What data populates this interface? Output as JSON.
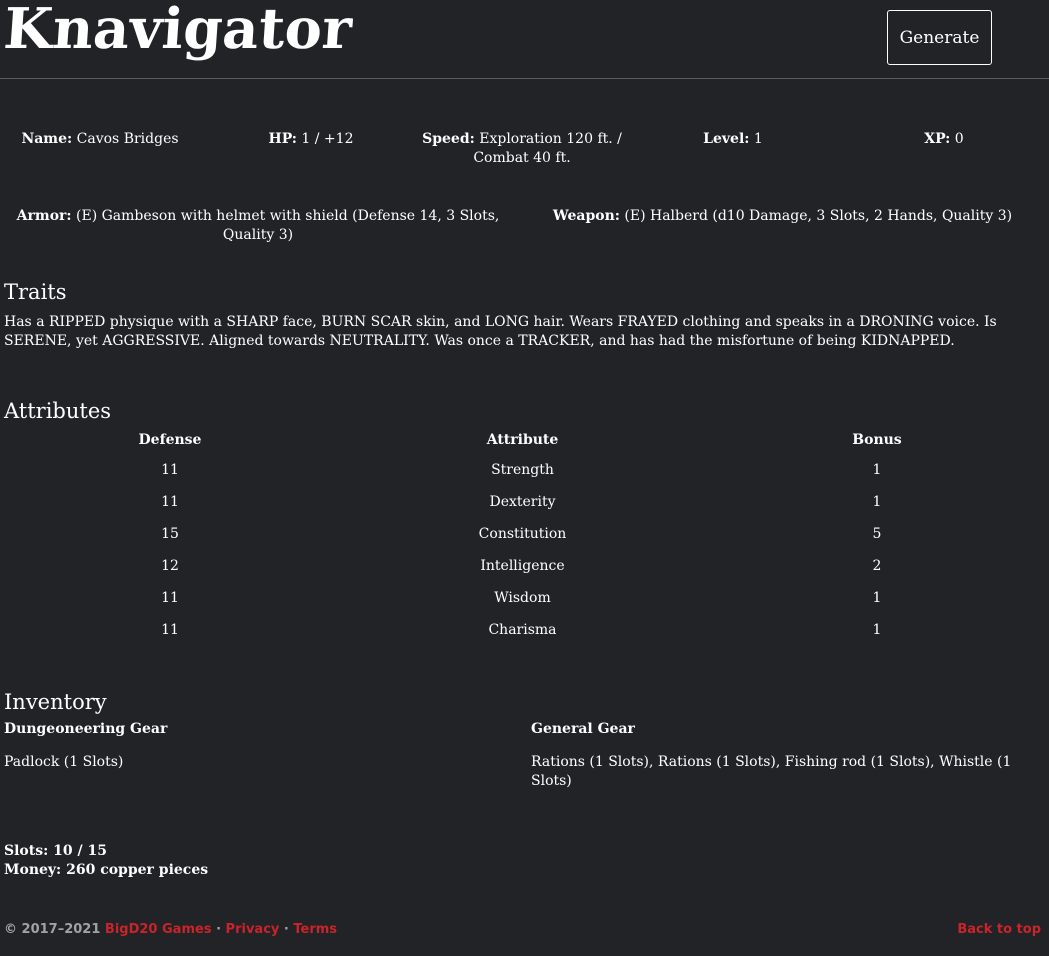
{
  "header": {
    "logo": "Knavigator",
    "generate_label": "Generate"
  },
  "character": {
    "name_label": "Name:",
    "name": "Cavos Bridges",
    "hp_label": "HP:",
    "hp": "1 / +12",
    "speed_label": "Speed:",
    "speed_line1": "Exploration 120 ft. /",
    "speed_line2": "Combat 40 ft.",
    "level_label": "Level:",
    "level": "1",
    "xp_label": "XP:",
    "xp": "0",
    "armor_label": "Armor:",
    "armor_line1": "(E) Gambeson with helmet with shield (Defense 14, 3 Slots,",
    "armor_line2": "Quality 3)",
    "weapon_label": "Weapon:",
    "weapon": "(E) Halberd (d10 Damage, 3 Slots, 2 Hands, Quality 3)"
  },
  "traits": {
    "title": "Traits",
    "text": "Has a RIPPED physique with a SHARP face, BURN SCAR skin, and LONG hair. Wears FRAYED clothing and speaks in a DRONING voice. Is SERENE, yet AGGRESSIVE. Aligned towards NEUTRALITY. Was once a TRACKER, and has had the misfortune of being KIDNAPPED."
  },
  "attributes": {
    "title": "Attributes",
    "headers": [
      "Defense",
      "Attribute",
      "Bonus"
    ],
    "rows": [
      [
        "11",
        "Strength",
        "1"
      ],
      [
        "11",
        "Dexterity",
        "1"
      ],
      [
        "15",
        "Constitution",
        "5"
      ],
      [
        "12",
        "Intelligence",
        "2"
      ],
      [
        "11",
        "Wisdom",
        "1"
      ],
      [
        "11",
        "Charisma",
        "1"
      ]
    ]
  },
  "inventory": {
    "title": "Inventory",
    "dungeoneering_label": "Dungeoneering Gear",
    "dungeoneering_items": "Padlock (1 Slots)",
    "general_label": "General Gear",
    "general_line1": "Rations (1 Slots), Rations (1 Slots), Fishing rod (1 Slots), Whistle (1",
    "general_line2": "Slots)",
    "slots": "Slots: 10 / 15",
    "money": "Money: 260 copper pieces"
  },
  "footer": {
    "copyright": "© 2017–2021",
    "company": "BigD20 Games",
    "sep1": " · ",
    "privacy": "Privacy",
    "sep2": " · ",
    "terms": "Terms",
    "back_to_top": "Back to top"
  },
  "colors": {
    "background": "#212327",
    "text": "#ffffff",
    "link": "#c8242a"
  }
}
